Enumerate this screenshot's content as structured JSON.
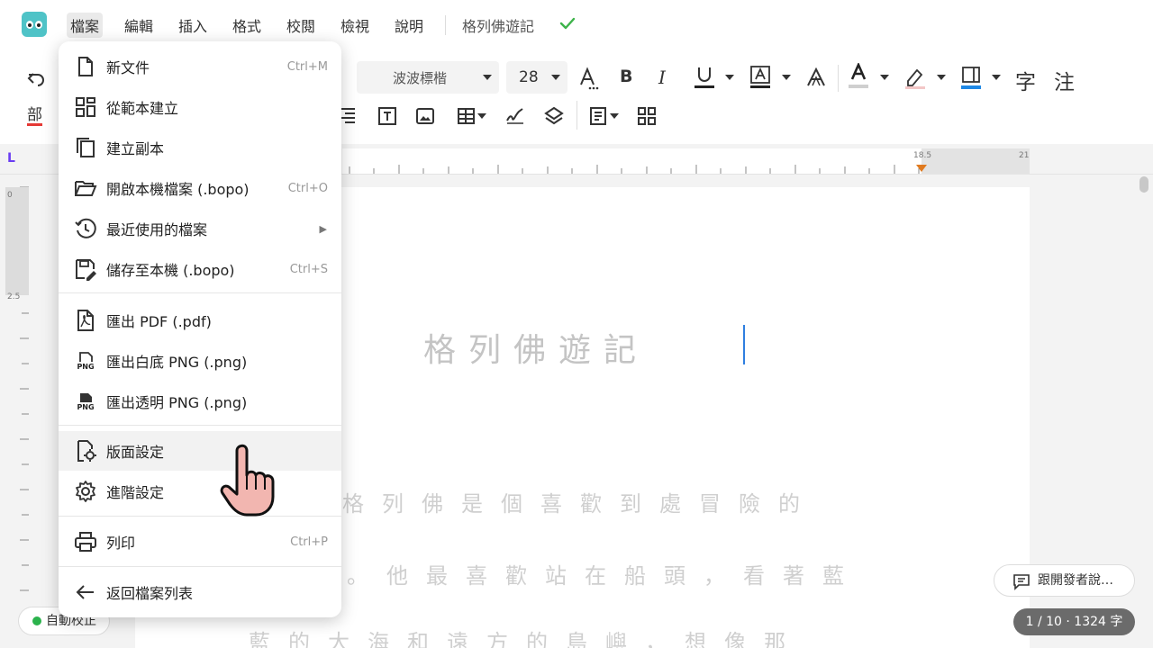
{
  "app": {
    "doc_title": "格列佛遊記"
  },
  "menubar": {
    "items": [
      "檔案",
      "編輯",
      "插入",
      "格式",
      "校閱",
      "檢視",
      "說明"
    ]
  },
  "toolbar": {
    "font_name": "波波標楷",
    "font_size": "28",
    "char_label": "字",
    "note_label": "注",
    "bushou_label": "部",
    "colors": {
      "text": "#222222",
      "highlight": "#e53935",
      "border": "#1e88e5"
    }
  },
  "ruler": {
    "label_right1": "18.5",
    "label_right2": "21",
    "vlabel_top": "0",
    "vlabel_mid": "2.5"
  },
  "file_menu": {
    "items": [
      {
        "label": "新文件",
        "shortcut": "Ctrl+M",
        "icon": "new-file-icon"
      },
      {
        "label": "從範本建立",
        "shortcut": "",
        "icon": "template-icon"
      },
      {
        "label": "建立副本",
        "shortcut": "",
        "icon": "copy-icon"
      },
      {
        "label": "開啟本機檔案 (.bopo)",
        "shortcut": "Ctrl+O",
        "icon": "folder-open-icon"
      },
      {
        "label": "最近使用的檔案",
        "shortcut": "",
        "icon": "history-icon"
      },
      {
        "label": "儲存至本機 (.bopo)",
        "shortcut": "Ctrl+S",
        "icon": "save-local-icon"
      },
      {
        "label": "匯出 PDF (.pdf)",
        "shortcut": "",
        "icon": "pdf-icon"
      },
      {
        "label": "匯出白底 PNG (.png)",
        "shortcut": "",
        "icon": "png-icon"
      },
      {
        "label": "匯出透明 PNG (.png)",
        "shortcut": "",
        "icon": "png-filled-icon"
      },
      {
        "label": "版面設定",
        "shortcut": "",
        "icon": "page-settings-icon"
      },
      {
        "label": "進階設定",
        "shortcut": "",
        "icon": "gear-icon"
      },
      {
        "label": "列印",
        "shortcut": "Ctrl+P",
        "icon": "printer-icon"
      },
      {
        "label": "返回檔案列表",
        "shortcut": "",
        "icon": "arrow-left-icon"
      }
    ],
    "png_tag": "PNG"
  },
  "document": {
    "heading": "格列佛遊記",
    "line1": "格列佛是個喜歡到處冒險的",
    "line2": "。他最喜歡站在船頭，看著藍",
    "line3": "藍的大海和遠方的島嶼，想像那"
  },
  "status": {
    "autocorrect": "自動校正",
    "feedback": "跟開發者說…",
    "page_count": "1 / 10 · 1324 字"
  }
}
